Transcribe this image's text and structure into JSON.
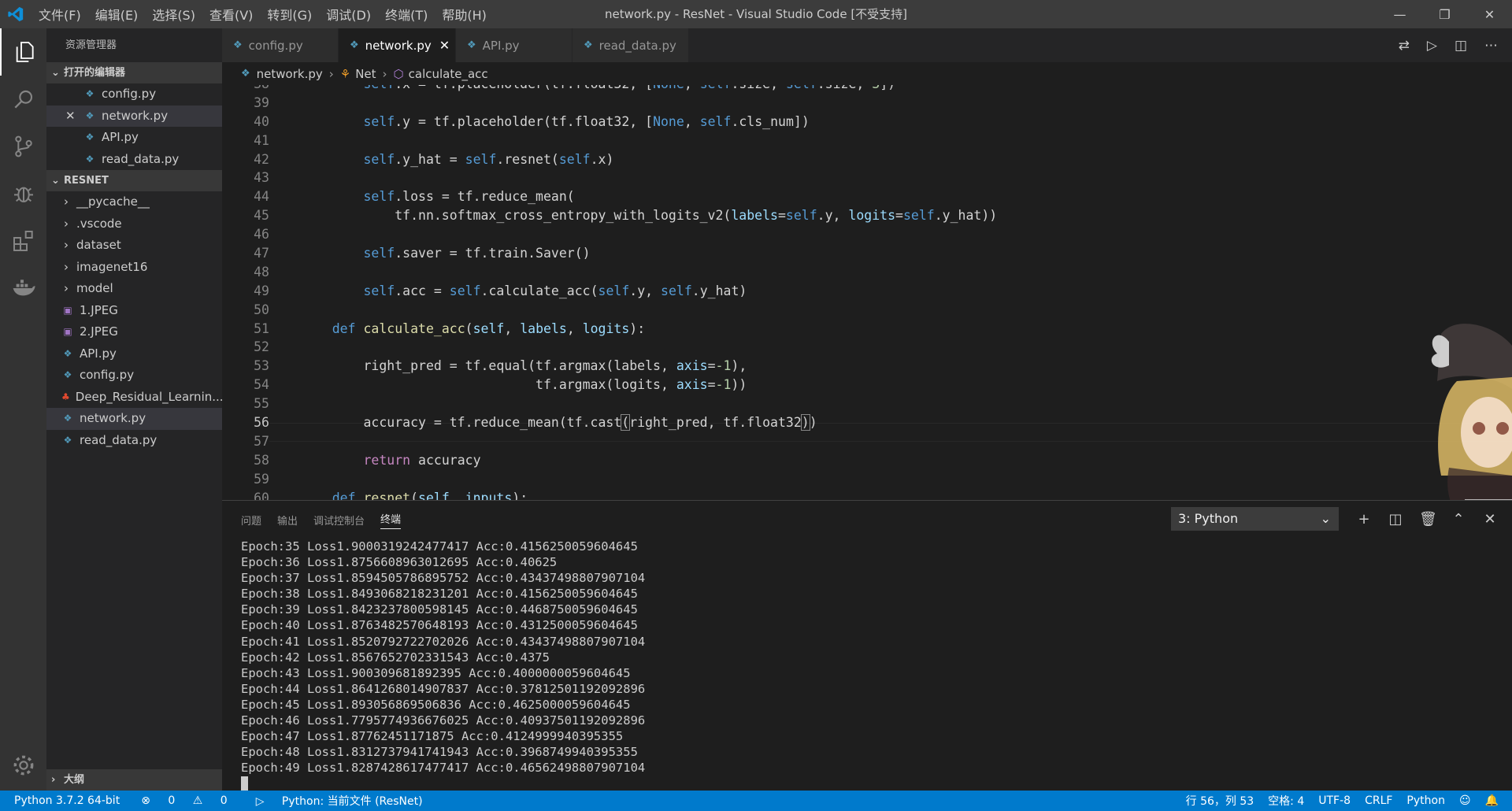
{
  "window": {
    "title": "network.py - ResNet - Visual Studio Code [不受支持]",
    "menu": [
      "文件(F)",
      "编辑(E)",
      "选择(S)",
      "查看(V)",
      "转到(G)",
      "调试(D)",
      "终端(T)",
      "帮助(H)"
    ],
    "controls": {
      "minimize": "minimize-icon",
      "restore": "restore-icon",
      "close": "close-icon"
    }
  },
  "colors": {
    "accent": "#007acc",
    "python_icon": "#519aba",
    "keyword": "#569cd6",
    "function": "#dcdcaa",
    "parameter": "#9cdcfe",
    "control": "#c586c0"
  },
  "sidebar": {
    "title": "资源管理器",
    "open_editors_label": "打开的编辑器",
    "open_editors": [
      "config.py",
      "network.py",
      "API.py",
      "read_data.py"
    ],
    "project_label": "RESNET",
    "folders": [
      "__pycache__",
      ".vscode",
      "dataset",
      "imagenet16",
      "model"
    ],
    "files": [
      {
        "name": "1.JPEG",
        "icon": "image-icon"
      },
      {
        "name": "2.JPEG",
        "icon": "image-icon"
      },
      {
        "name": "API.py",
        "icon": "python-icon"
      },
      {
        "name": "config.py",
        "icon": "python-icon"
      },
      {
        "name": "Deep_Residual_Learnin...",
        "icon": "pdf-icon"
      },
      {
        "name": "network.py",
        "icon": "python-icon"
      },
      {
        "name": "read_data.py",
        "icon": "python-icon"
      }
    ],
    "outline_label": "大纲"
  },
  "tabs": [
    "config.py",
    "network.py",
    "API.py",
    "read_data.py"
  ],
  "breadcrumb": [
    "network.py",
    "Net",
    "calculate_acc"
  ],
  "editor": {
    "line_numbers": [
      "38",
      "39",
      "40",
      "41",
      "42",
      "43",
      "44",
      "45",
      "46",
      "47",
      "48",
      "49",
      "50",
      "51",
      "52",
      "53",
      "54",
      "55",
      "56",
      "57",
      "58",
      "59",
      "60"
    ],
    "current_line": "56"
  },
  "panel": {
    "tabs": [
      "问题",
      "输出",
      "调试控制台",
      "终端"
    ],
    "terminal_select": "3: Python",
    "terminal_lines": [
      "Epoch:35 Loss1.9000319242477417 Acc:0.4156250059604645",
      "Epoch:36 Loss1.8756608963012695 Acc:0.40625",
      "Epoch:37 Loss1.8594505786895752 Acc:0.43437498807907104",
      "Epoch:38 Loss1.8493068218231201 Acc:0.4156250059604645",
      "Epoch:39 Loss1.8423237800598145 Acc:0.4468750059604645",
      "Epoch:40 Loss1.8763482570648193 Acc:0.4312500059604645",
      "Epoch:41 Loss1.8520792722702026 Acc:0.43437498807907104",
      "Epoch:42 Loss1.8567652702331543 Acc:0.4375",
      "Epoch:43 Loss1.900309681892395 Acc:0.4000000059604645",
      "Epoch:44 Loss1.8641268014907837 Acc:0.37812501192092896",
      "Epoch:45 Loss1.893056869506836 Acc:0.4625000059604645",
      "Epoch:46 Loss1.7795774936676025 Acc:0.40937501192092896",
      "Epoch:47 Loss1.87762451171875 Acc:0.4124999940395355",
      "Epoch:48 Loss1.8312737941741943 Acc:0.3968749940395355",
      "Epoch:49 Loss1.8287428617477417 Acc:0.46562498807907104"
    ]
  },
  "statusbar": {
    "interpreter": "Python 3.7.2 64-bit",
    "errors": "0",
    "warnings": "0",
    "run_target": "Python: 当前文件 (ResNet)",
    "cursor_pos": "行 56，列 53",
    "indent": "空格: 4",
    "encoding": "UTF-8",
    "eol": "CRLF",
    "language": "Python"
  }
}
